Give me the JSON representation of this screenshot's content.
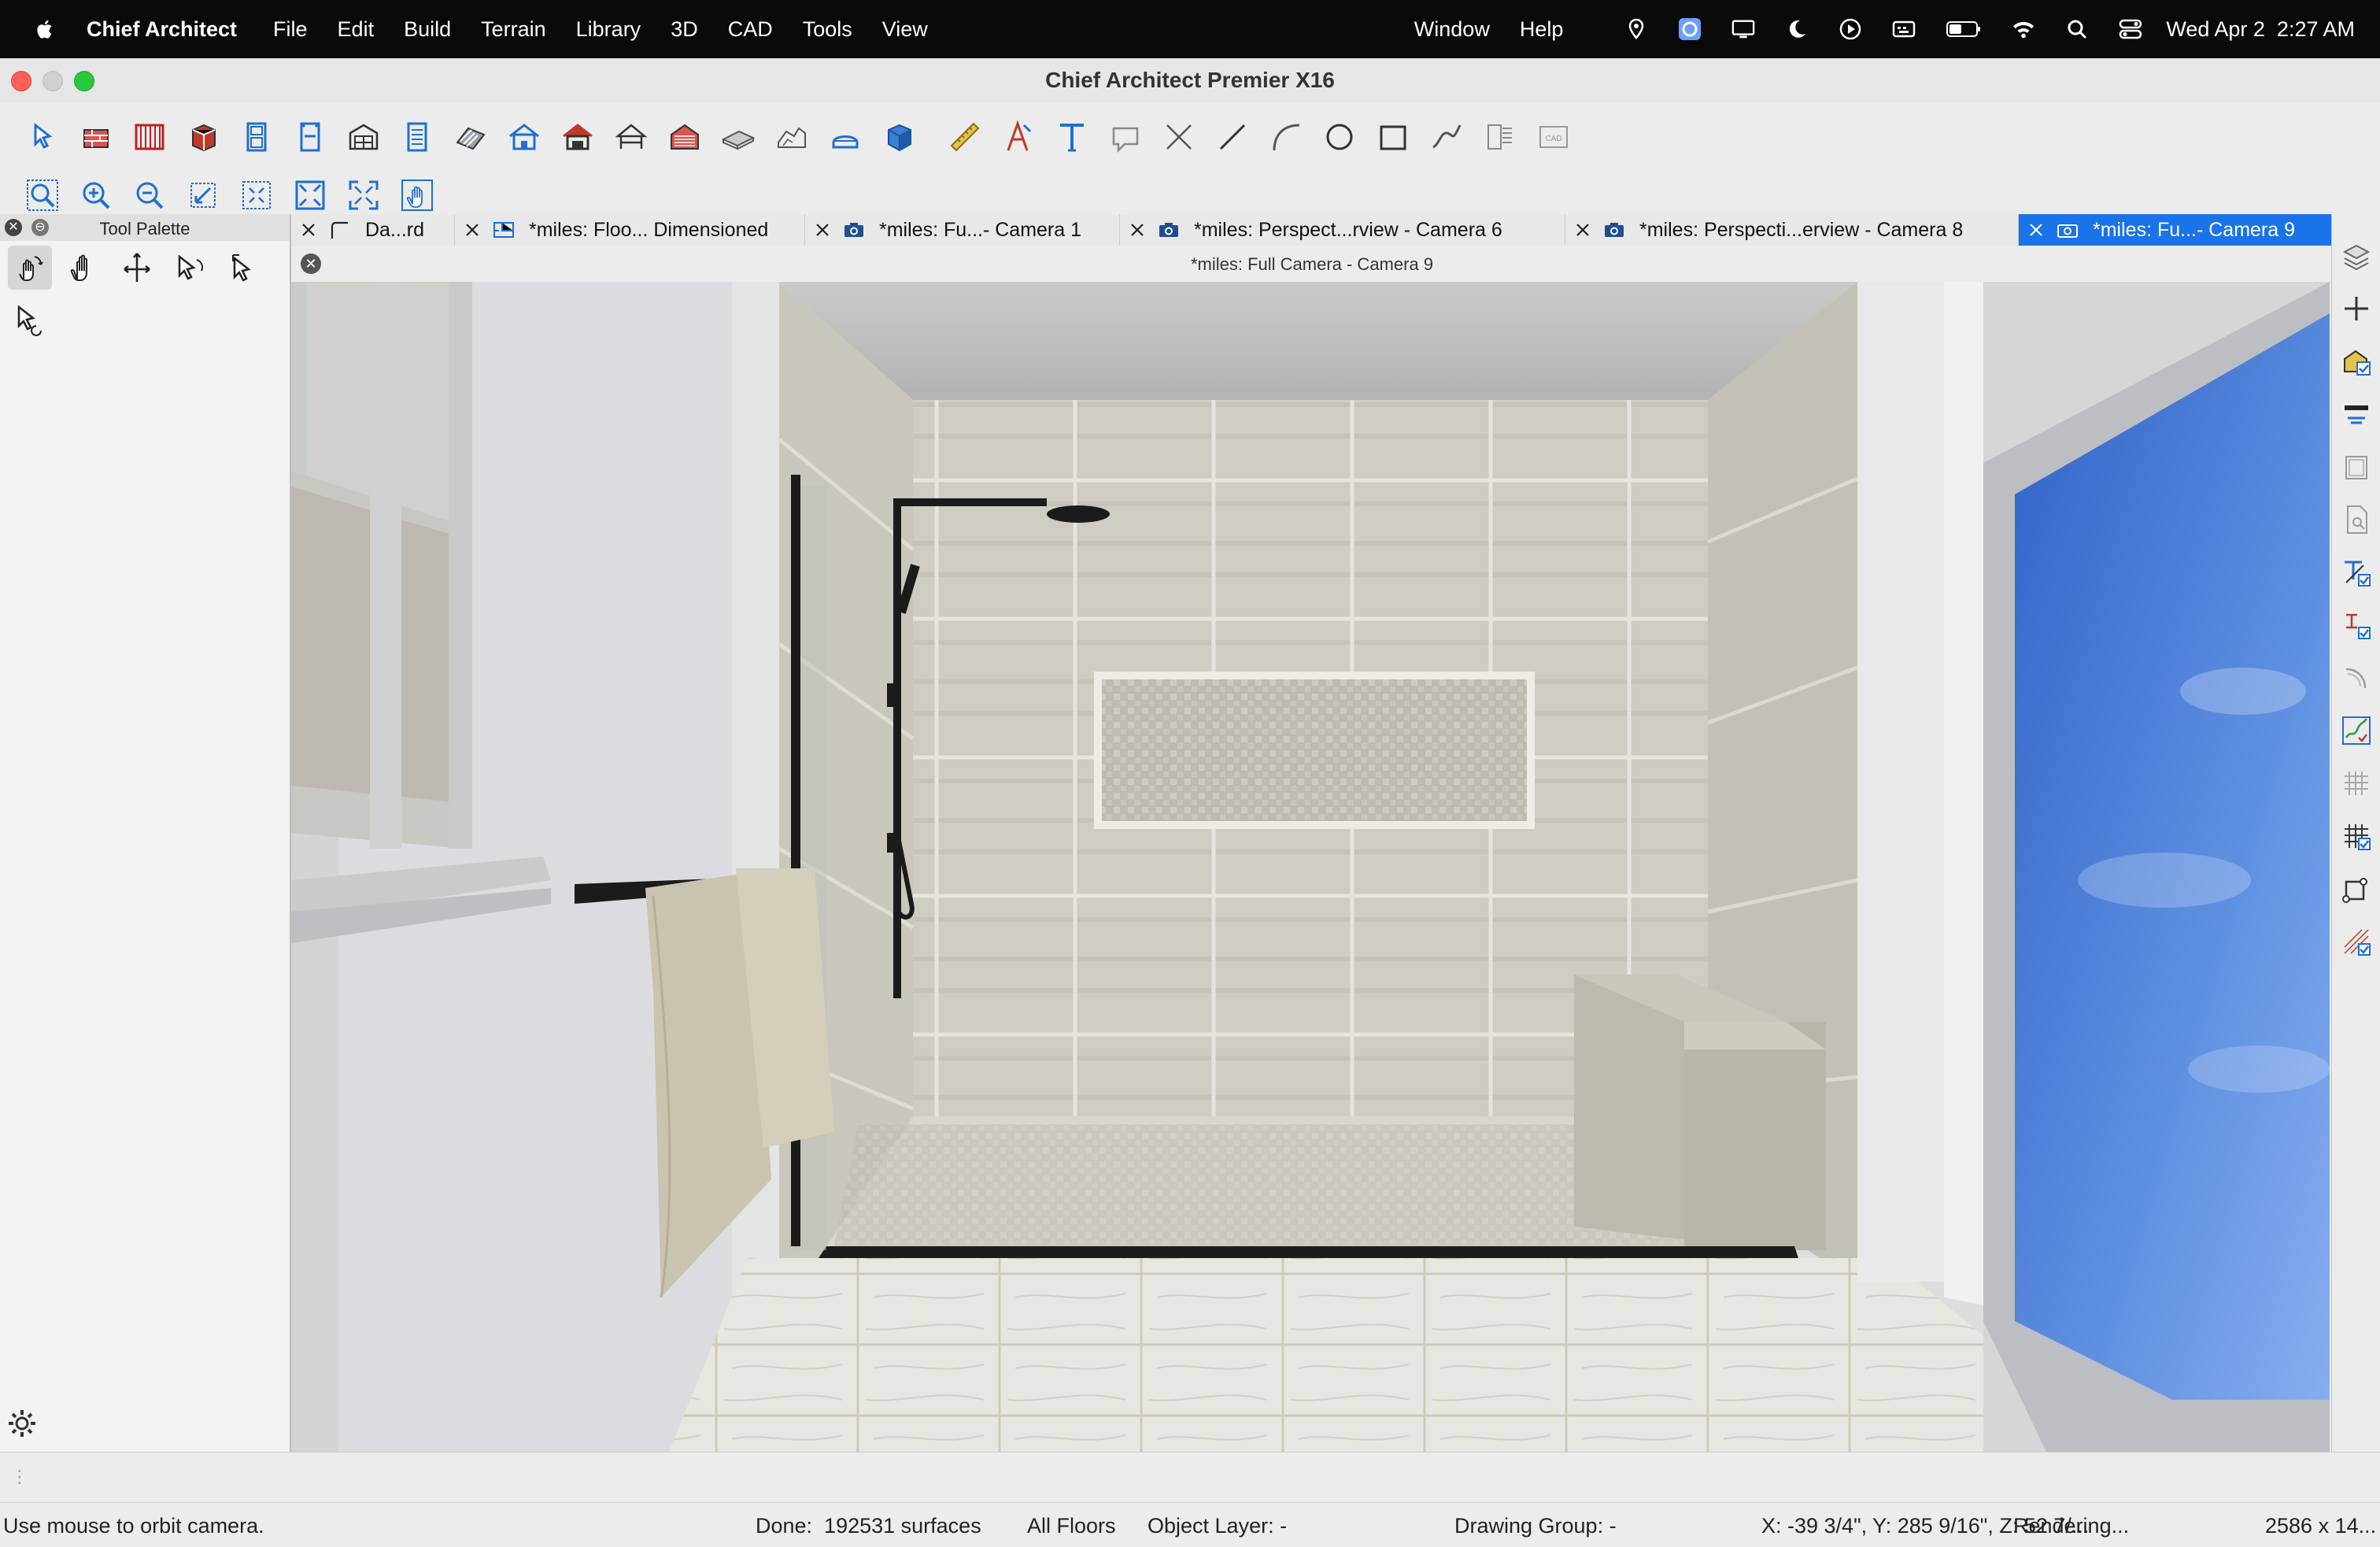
{
  "menubar": {
    "app_name": "Chief Architect",
    "items": [
      "File",
      "Edit",
      "Build",
      "Terrain",
      "Library",
      "3D",
      "CAD",
      "Tools",
      "View"
    ],
    "right_items": [
      "Window",
      "Help"
    ],
    "clock": "Wed Apr 2  2:27 AM",
    "status_icons": [
      "location-icon",
      "app-switcher-icon",
      "display-icon",
      "focus-moon-icon",
      "play-icon",
      "keyboard-icon",
      "battery-icon",
      "wifi-icon",
      "spotlight-search-icon",
      "control-center-icon"
    ]
  },
  "window": {
    "title": "Chief Architect Premier X16"
  },
  "toolbar1": {
    "icons": [
      "select-objects-icon",
      "wall-tool-icon",
      "railing-icon",
      "cabinet-icon",
      "door-icon",
      "window-icon",
      "framing-icon",
      "stair-icon",
      "roof-icon",
      "house-icon",
      "garage-icon",
      "barn-icon",
      "gazebo-icon",
      "slab-icon",
      "terrain-icon",
      "shower-icon",
      "box-3d-icon",
      "measure-icon",
      "dimension-icon",
      "text-icon",
      "callout-icon",
      "cross-line-icon",
      "line-icon",
      "arc-icon",
      "circle-icon",
      "rectangle-icon",
      "spline-icon",
      "layout-icon",
      "cad-block-icon"
    ]
  },
  "toolbar2": {
    "icons": [
      "zoom-tool-icon",
      "zoom-in-icon",
      "zoom-out-icon",
      "undo-zoom-icon",
      "fill-window-icon",
      "fill-window-building-icon",
      "full-extents-icon",
      "pan-window-icon"
    ]
  },
  "palette": {
    "title": "Tool Palette",
    "tools": [
      "orbit-camera-icon",
      "pan-camera-icon",
      "move-camera-icon",
      "rotate-camera-icon",
      "tilt-camera-icon",
      "mouse-orbit-icon"
    ]
  },
  "tabs": [
    {
      "label": "Da...rd",
      "icon": "elevation-icon"
    },
    {
      "label": "*miles: Floo... Dimensioned",
      "icon": "floor-plan-icon"
    },
    {
      "label": "*miles: Fu...- Camera 1",
      "icon": "camera-icon"
    },
    {
      "label": "*miles: Perspect...rview - Camera 6",
      "icon": "camera-icon"
    },
    {
      "label": "*miles: Perspecti...erview - Camera 8",
      "icon": "camera-icon"
    },
    {
      "label": "*miles: Fu...- Camera 9",
      "icon": "camera-icon"
    }
  ],
  "view": {
    "title": "*miles: Full Camera - Camera 9"
  },
  "rightbar": {
    "icons": [
      "layer-stack-icon",
      "add-icon",
      "material-icon",
      "plane-icon",
      "rectangle-outline-icon",
      "page-search-icon",
      "text-check-icon",
      "dimension-check-icon",
      "curve-icon",
      "chart-check-icon",
      "grid-icon",
      "grid-check-icon",
      "object-check-icon",
      "cross-section-icon"
    ]
  },
  "status": {
    "hint": "Use mouse to orbit camera.",
    "done": "Done:  192531 surfaces",
    "floors": "All Floors",
    "object_layer": "Object Layer: -",
    "drawing_group": "Drawing Group: -",
    "coords": "X: -39 3/4\", Y: 285 9/16\", Z: 52 7/...",
    "rendering": "Rendering...",
    "size": "2586 x 14..."
  }
}
